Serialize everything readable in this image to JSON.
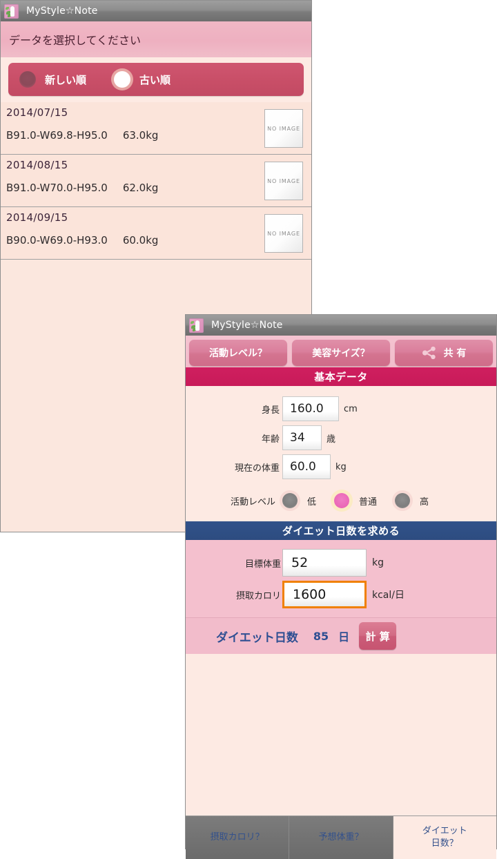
{
  "window1": {
    "title": "MyStyle☆Note",
    "app_icon": "app-logo-icon",
    "prompt": "データを選択してください",
    "sort": {
      "options": [
        {
          "label": "新しい順",
          "selected": false
        },
        {
          "label": "古い順",
          "selected": true
        }
      ]
    },
    "list": {
      "thumb_placeholder": "NO IMAGE",
      "items": [
        {
          "date": "2014/07/15",
          "measurements": "B91.0-W69.8-H95.0",
          "weight": "63.0kg"
        },
        {
          "date": "2014/08/15",
          "measurements": "B91.0-W70.0-H95.0",
          "weight": "62.0kg"
        },
        {
          "date": "2014/09/15",
          "measurements": "B90.0-W69.0-H93.0",
          "weight": "60.0kg"
        }
      ]
    }
  },
  "window2": {
    "title": "MyStyle☆Note",
    "app_icon": "app-logo-icon",
    "toolbar": {
      "activity_level_help": "活動レベル？",
      "beauty_size_help": "美容サイズ？",
      "share_label": "共 有",
      "share_icon": "share-icon"
    },
    "basic_section": {
      "header": "基本データ",
      "fields": [
        {
          "label": "身長",
          "value": "160.0",
          "unit": "cm"
        },
        {
          "label": "年齢",
          "value": "34",
          "unit": "歳"
        },
        {
          "label": "現在の体重",
          "value": "60.0",
          "unit": "kg"
        }
      ],
      "activity": {
        "label": "活動レベル",
        "options": [
          {
            "label": "低",
            "selected": false
          },
          {
            "label": "普通",
            "selected": true
          },
          {
            "label": "高",
            "selected": false
          }
        ]
      }
    },
    "diet_section": {
      "header": "ダイエット日数を求める",
      "target_weight": {
        "label": "目標体重",
        "value": "52",
        "unit": "kg"
      },
      "calories": {
        "label": "摂取カロリ",
        "value": "1600",
        "unit": "kcal/日",
        "focused": true
      },
      "result": {
        "label": "ダイエット日数",
        "value": "85",
        "unit": "日",
        "calc_button": "計 算"
      }
    },
    "tabbar": {
      "tabs": [
        {
          "label": "摂取カロリ？",
          "active": false
        },
        {
          "label": "予想体重？",
          "active": false
        },
        {
          "label_line1": "ダイエット",
          "label_line2": "日数？",
          "active": true
        }
      ]
    }
  },
  "colors": {
    "accent_pink": "#c81a59",
    "accent_blue": "#2d4c80",
    "focus_orange": "#f08000",
    "panel_bg": "#fdeae3",
    "panel_pink": "#f4c0ce"
  }
}
